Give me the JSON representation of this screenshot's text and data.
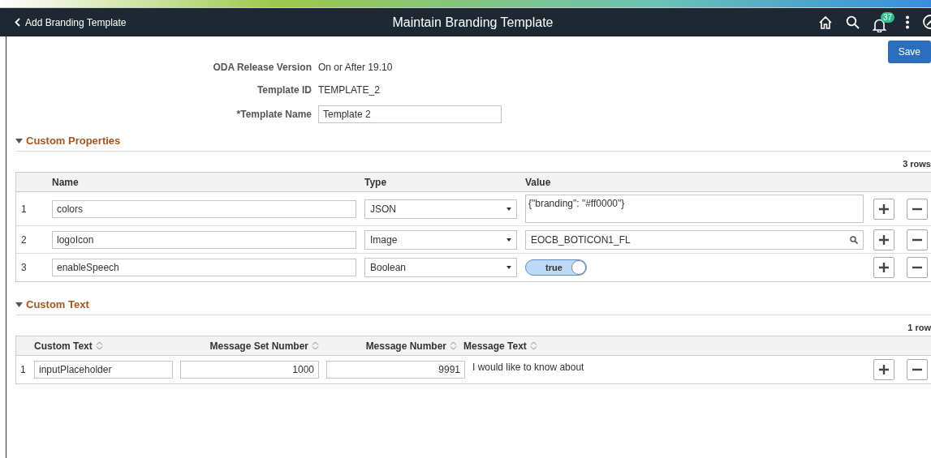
{
  "header": {
    "back_label": "Add Branding Template",
    "title": "Maintain Branding Template",
    "notification_count": "37"
  },
  "save_button": "Save",
  "fields": [
    {
      "label": "ODA Release Version",
      "value": "On or After 19.10",
      "kind": "text"
    },
    {
      "label": "Template ID",
      "value": "TEMPLATE_2",
      "kind": "text"
    },
    {
      "label": "*Template Name",
      "value": "Template 2",
      "kind": "input"
    }
  ],
  "custom_properties": {
    "title": "Custom Properties",
    "expanded": true,
    "row_count": "3 rows",
    "columns": [
      "Name",
      "Type",
      "Value"
    ],
    "rows": [
      {
        "number": "1",
        "name": "colors",
        "type": "JSON",
        "kind": "textarea",
        "value": "{\"branding\": \"#ff0000\"}"
      },
      {
        "number": "2",
        "name": "logoIcon",
        "type": "Image",
        "kind": "lookup",
        "value": "EOCB_BOTICON1_FL"
      },
      {
        "number": "3",
        "name": "enableSpeech",
        "type": "Boolean",
        "kind": "toggle",
        "value": "true",
        "on": true
      }
    ]
  },
  "custom_text": {
    "title": "Custom Text",
    "expanded": true,
    "row_count": "1 row",
    "columns": [
      "Custom Text",
      "Message Set Number",
      "Message Number",
      "Message Text"
    ],
    "rows": [
      {
        "number": "1",
        "custom_text": "inputPlaceholder",
        "message_set_number": "1000",
        "message_number": "9991",
        "message_text": "I would like to know about"
      }
    ]
  }
}
